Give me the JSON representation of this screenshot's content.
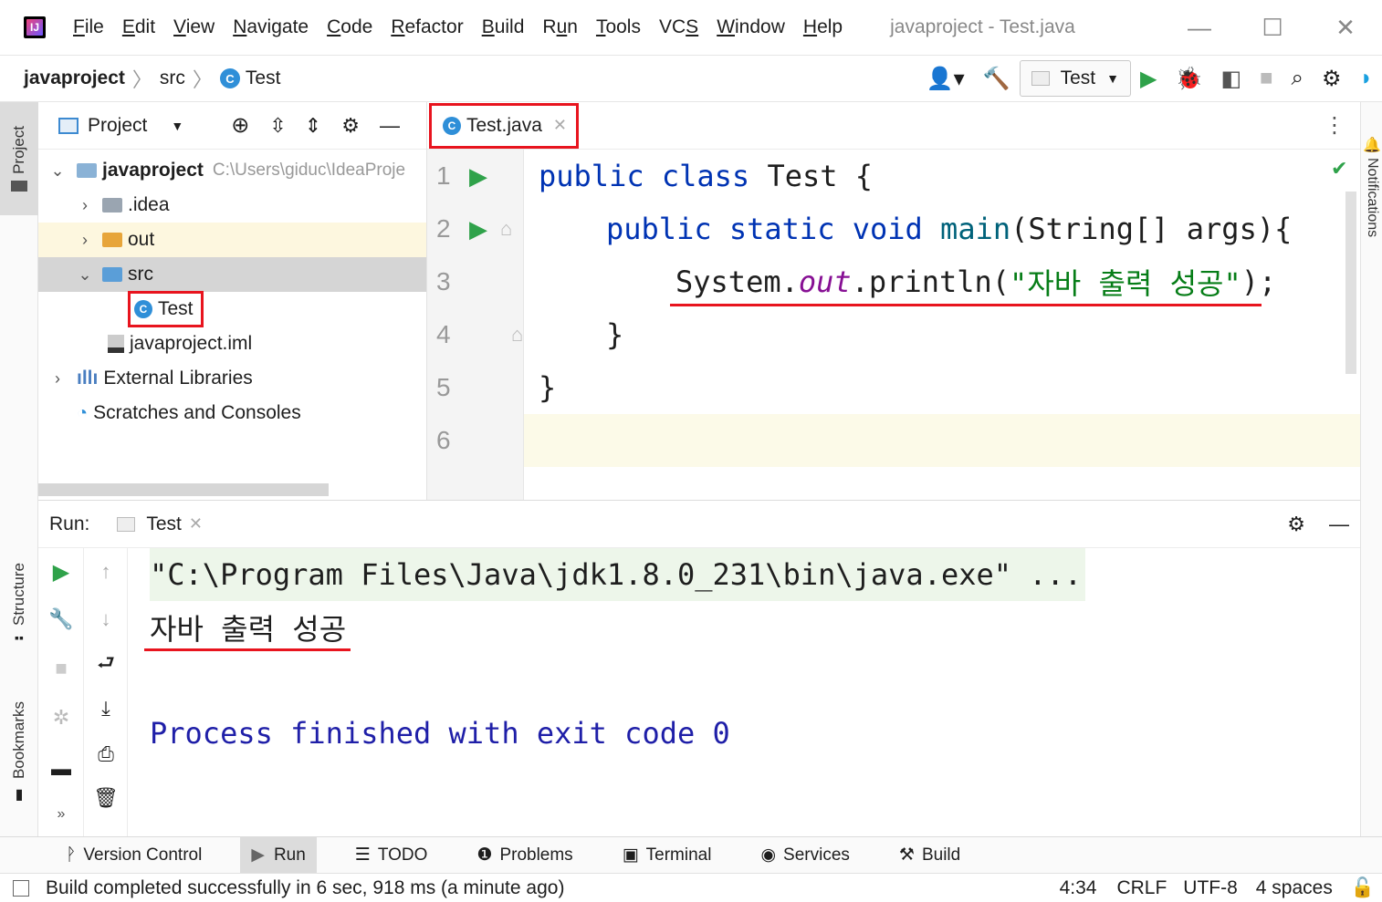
{
  "menu": {
    "items": [
      "File",
      "Edit",
      "View",
      "Navigate",
      "Code",
      "Refactor",
      "Build",
      "Run",
      "Tools",
      "VCS",
      "Window",
      "Help"
    ],
    "mnemonics": [
      "F",
      "E",
      "V",
      "N",
      "C",
      "R",
      "B",
      "u",
      "T",
      "S",
      "W",
      "H"
    ],
    "window_title": "javaproject - Test.java"
  },
  "navbar": {
    "breadcrumb": [
      "javaproject",
      "src",
      "Test"
    ],
    "run_config": "Test"
  },
  "left_strip": {
    "project_label": "Project",
    "structure_label": "Structure",
    "bookmarks_label": "Bookmarks"
  },
  "right_strip": {
    "notifications_label": "Notifications"
  },
  "project_panel": {
    "title": "Project",
    "root": {
      "name": "javaproject",
      "path": "C:\\Users\\giduc\\IdeaProje"
    },
    "items": [
      {
        "name": ".idea"
      },
      {
        "name": "out"
      },
      {
        "name": "src"
      },
      {
        "name": "Test"
      },
      {
        "name": "javaproject.iml"
      },
      {
        "name": "External Libraries"
      },
      {
        "name": "Scratches and Consoles"
      }
    ]
  },
  "editor": {
    "tab": "Test.java",
    "line_numbers": [
      "1",
      "2",
      "3",
      "4",
      "5",
      "6"
    ],
    "code": {
      "l1_kw1": "public",
      "l1_kw2": "class",
      "l1_rest": " Test {",
      "l2_kw1": "public",
      "l2_kw2": "static",
      "l2_kw3": "void",
      "l2_fn": "main",
      "l2_rest": "(String[] args){",
      "l3_a": "System.",
      "l3_field": "out",
      "l3_b": ".println(",
      "l3_str": "\"자바 출력 성공\"",
      "l3_c": ");",
      "l4": "}",
      "l5": "}"
    }
  },
  "run_panel": {
    "label": "Run:",
    "tab": "Test",
    "console": {
      "command": "\"C:\\Program Files\\Java\\jdk1.8.0_231\\bin\\java.exe\" ...",
      "output": "자바 출력 성공",
      "finished": "Process finished with exit code 0"
    }
  },
  "tool_windows": [
    "Version Control",
    "Run",
    "TODO",
    "Problems",
    "Terminal",
    "Services",
    "Build"
  ],
  "status_bar": {
    "message": "Build completed successfully in 6 sec, 918 ms (a minute ago)",
    "position": "4:34",
    "line_sep": "CRLF",
    "encoding": "UTF-8",
    "indent": "4 spaces"
  },
  "colors": {
    "accent_red": "#e8141e",
    "keyword": "#0033b3",
    "string": "#067d17",
    "field": "#871094",
    "run_green": "#2fa24a"
  }
}
